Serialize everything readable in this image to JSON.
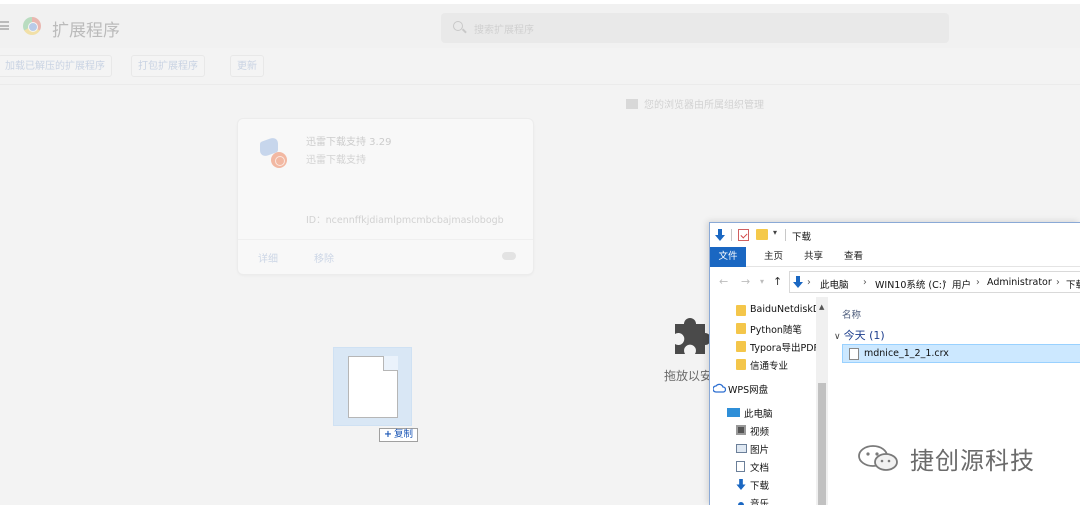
{
  "chrome_ext": {
    "title": "扩展程序",
    "search_placeholder": "搜索扩展程序",
    "toolbar": {
      "load_unpacked": "加载已解压的扩展程序",
      "pack": "打包扩展程序",
      "update": "更新"
    },
    "managed_note": "您的浏览器由所属组织管理",
    "card": {
      "name": "迅雷下载支持 3.29",
      "description": "迅雷下载支持",
      "id_text": "ID：ncennffkjdiamlpmcmbcbajmaslobogb",
      "details_label": "详细",
      "remove_label": "移除"
    },
    "drop_hint": "拖放以安"
  },
  "drag": {
    "copy_label": "复制",
    "copy_symbol": "+"
  },
  "explorer": {
    "window_title": "下载",
    "ribbon_tabs": [
      "文件",
      "主页",
      "共享",
      "查看"
    ],
    "breadcrumbs": [
      "此电脑",
      "WIN10系统 (C:)",
      "用户",
      "Administrator",
      "下载"
    ],
    "nav_items": [
      {
        "label": "BaiduNetdiskD",
        "icon": "folder-icon"
      },
      {
        "label": "Python随笔",
        "icon": "folder-icon"
      },
      {
        "label": "Typora导出PDF",
        "icon": "folder-icon"
      },
      {
        "label": "信通专业",
        "icon": "folder-icon"
      },
      {
        "label": "WPS网盘",
        "icon": "cloud-icon"
      },
      {
        "label": "此电脑",
        "icon": "computer-icon"
      },
      {
        "label": "视频",
        "icon": "video-icon"
      },
      {
        "label": "图片",
        "icon": "picture-icon"
      },
      {
        "label": "文档",
        "icon": "document-icon"
      },
      {
        "label": "下载",
        "icon": "download-icon"
      },
      {
        "label": "音乐",
        "icon": "music-icon"
      }
    ],
    "column_name": "名称",
    "group_label": "今天 (1)",
    "file_name": "mdnice_1_2_1.crx"
  },
  "watermark": "捷创源科技",
  "colors": {
    "ribbon_file_tab": "#1a67c2",
    "selection": "#cce8ff",
    "group_text": "#1e3f8e"
  }
}
